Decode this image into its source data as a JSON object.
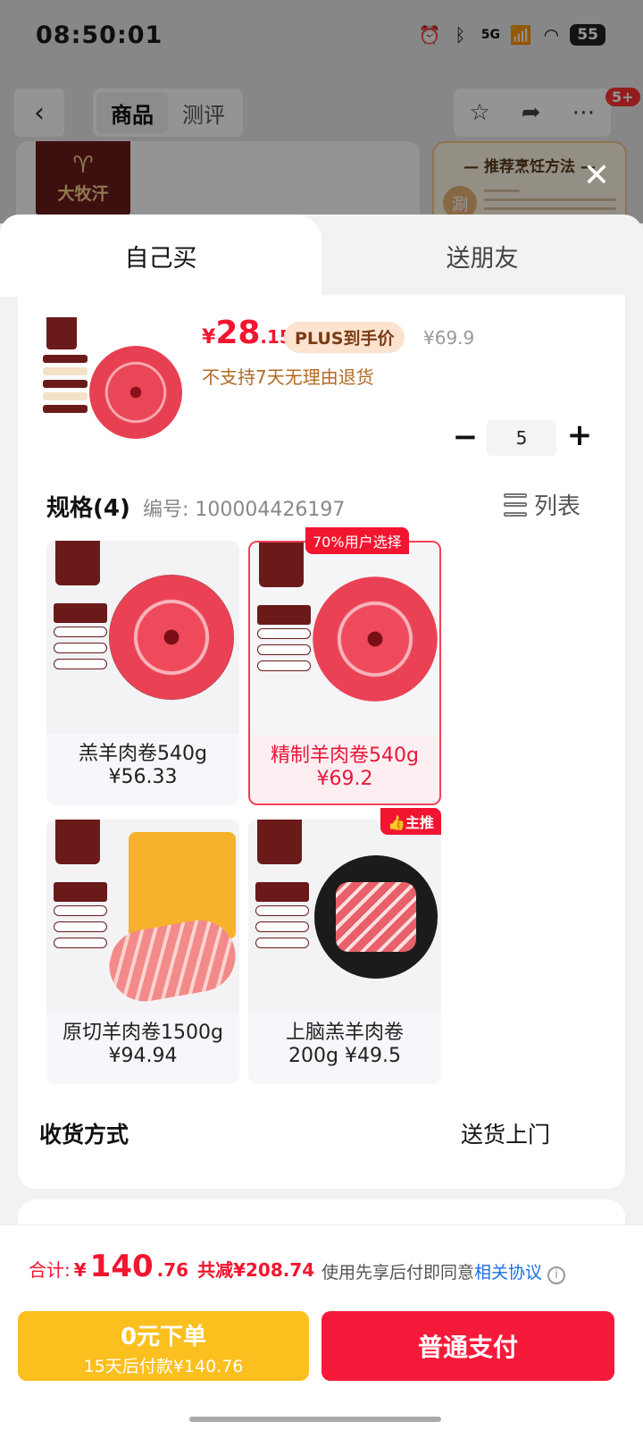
{
  "status_bar": {
    "time": "08:50:01",
    "battery": "55",
    "network": "5G"
  },
  "background_page": {
    "tabs": [
      "商品",
      "测评"
    ],
    "active_tab": "商品",
    "message_badge": "5+",
    "brand_name": "大牧汗",
    "recommend_title": "— 推荐烹饪方法 —",
    "recommend_method": "涮"
  },
  "sheet": {
    "tab_self": "自己买",
    "tab_gift": "送朋友",
    "product": {
      "price_currency": "¥",
      "price_int": "28",
      "price_dec": ".15",
      "plus_tag": "PLUS到手价",
      "original_price": "¥69.9",
      "return_policy": "不支持7天无理由退货",
      "quantity": "5"
    },
    "spec": {
      "title": "规格(4)",
      "number": "编号: 100004426197",
      "list_label": "列表"
    },
    "variants": [
      {
        "name": "羔羊肉卷540g",
        "price": "¥56.33",
        "selected": false
      },
      {
        "name": "精制羊肉卷540g",
        "price": "¥69.2",
        "selected": true
      },
      {
        "name": "原切羊肉卷1500g",
        "price": "¥94.94",
        "selected": false
      },
      {
        "name": "上脑羔羊肉卷",
        "price": "200g ¥49.5",
        "selected": false
      }
    ],
    "selected_tag": "70%用户选择",
    "main_push_tag": "主推",
    "shipping_label": "收货方式",
    "shipping_value": "送货上门"
  },
  "bottom": {
    "total_label": "合计:",
    "total_currency": "¥",
    "total_int": "140",
    "total_dec": ".76",
    "discount": "共减¥208.74",
    "agreement_prefix": "使用先享后付即同意",
    "agreement_link": "相关协议",
    "credit_button": "0元下单",
    "credit_sub": "15天后付款¥140.76",
    "pay_button": "普通支付"
  },
  "colors": {
    "accent": "#f2152f",
    "credit": "#fbbf1e",
    "brand": "#6b1a1a"
  }
}
